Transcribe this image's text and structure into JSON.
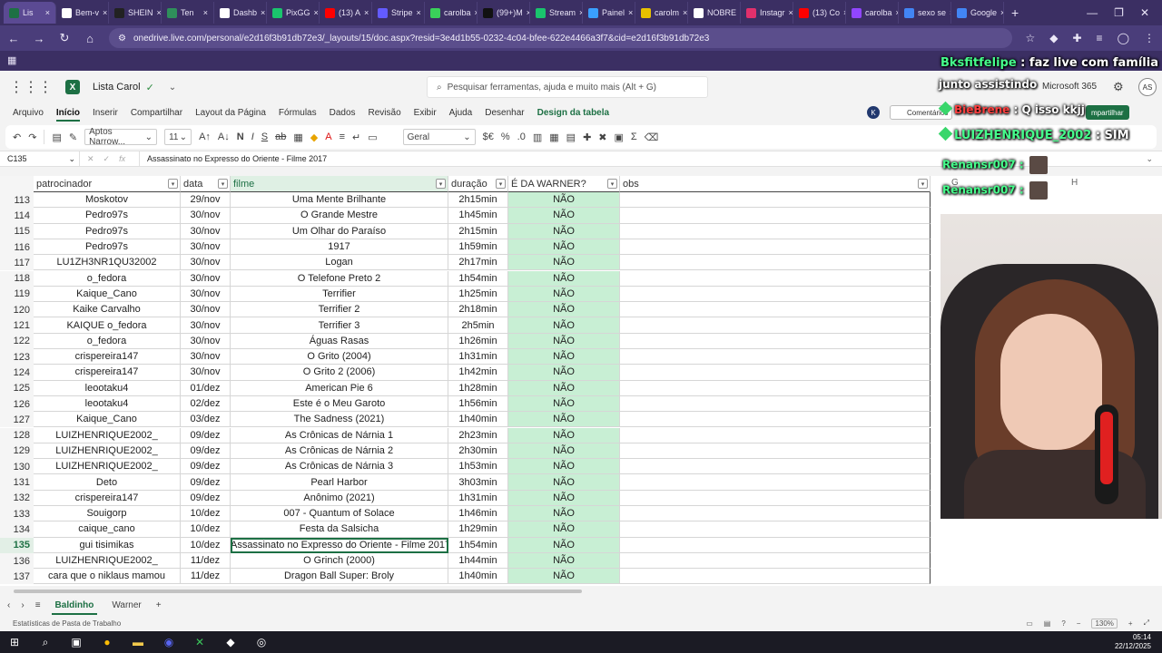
{
  "browser": {
    "tabs": [
      {
        "label": "Lis",
        "color": "#1d7044",
        "active": true
      },
      {
        "label": "Bem-v",
        "color": "#ffffff"
      },
      {
        "label": "SHEIN",
        "color": "#222222"
      },
      {
        "label": "Ten",
        "color": "#2f8f5b"
      },
      {
        "label": "Dashb",
        "color": "#ffffff"
      },
      {
        "label": "PixGG",
        "color": "#1ac46d"
      },
      {
        "label": "(13) A",
        "color": "#ff0000"
      },
      {
        "label": "Stripe",
        "color": "#635bff"
      },
      {
        "label": "carolba",
        "color": "#3ad15a"
      },
      {
        "label": "(99+)M",
        "color": "#111111"
      },
      {
        "label": "Stream",
        "color": "#1ac46d"
      },
      {
        "label": "Painel",
        "color": "#3aa0ff"
      },
      {
        "label": "carolm",
        "color": "#e8c100"
      },
      {
        "label": "NOBRE",
        "color": "#ffffff"
      },
      {
        "label": "Instagr",
        "color": "#e1306c"
      },
      {
        "label": "(13) Co",
        "color": "#ff0000"
      },
      {
        "label": "carolba",
        "color": "#9146ff"
      },
      {
        "label": "sexo se",
        "color": "#4285f4"
      },
      {
        "label": "Google",
        "color": "#4285f4"
      }
    ],
    "url": "onedrive.live.com/personal/e2d16f3b91db72e3/_layouts/15/doc.aspx?resid=3e4d1b55-0232-4c04-bfee-622e4466a3f7&cid=e2d16f3b91db72e3"
  },
  "excel": {
    "doc_name": "Lista Carol",
    "search_placeholder": "Pesquisar ferramentas, ajuda e muito mais (Alt + G)",
    "brand": "Microsoft 365",
    "avatar_initials": "AS",
    "k_badge": "K",
    "comments_label": "Comentários",
    "share_label": "mpartilhar",
    "menu_tabs": [
      "Arquivo",
      "Início",
      "Inserir",
      "Compartilhar",
      "Layout da Página",
      "Fórmulas",
      "Dados",
      "Revisão",
      "Exibir",
      "Ajuda",
      "Desenhar",
      "Design da tabela"
    ],
    "font_name": "Aptos Narrow...",
    "font_size": "11",
    "number_format": "Geral",
    "name_box": "C135",
    "formula": "Assassinato no Expresso do Oriente - Filme 2017",
    "columns": {
      "patrocinador": "patrocinador",
      "data": "data",
      "filme": "filme",
      "duracao": "duração",
      "warner": "É DA WARNER?",
      "obs": "obs",
      "g": "G",
      "h": "H"
    },
    "rows": [
      {
        "n": "113",
        "pat": "Moskotov",
        "data": "29/nov",
        "filme": "Uma Mente Brilhante",
        "dur": "2h15min",
        "warner": "NÃO"
      },
      {
        "n": "114",
        "pat": "Pedro97s",
        "data": "30/nov",
        "filme": "O Grande Mestre",
        "dur": "1h45min",
        "warner": "NÃO"
      },
      {
        "n": "115",
        "pat": "Pedro97s",
        "data": "30/nov",
        "filme": "Um Olhar do Paraíso",
        "dur": "2h15min",
        "warner": "NÃO"
      },
      {
        "n": "116",
        "pat": "Pedro97s",
        "data": "30/nov",
        "filme": "1917",
        "dur": "1h59min",
        "warner": "NÃO"
      },
      {
        "n": "117",
        "pat": "LU1ZH3NR1QU32002",
        "data": "30/nov",
        "filme": "Logan",
        "dur": "2h17min",
        "warner": "NÃO"
      },
      {
        "n": "118",
        "pat": "o_fedora",
        "data": "30/nov",
        "filme": "O Telefone Preto 2",
        "dur": "1h54min",
        "warner": "NÃO"
      },
      {
        "n": "119",
        "pat": "Kaique_Cano",
        "data": "30/nov",
        "filme": "Terrifier",
        "dur": "1h25min",
        "warner": "NÃO"
      },
      {
        "n": "120",
        "pat": "Kaike Carvalho",
        "data": "30/nov",
        "filme": "Terrifier  2",
        "dur": "2h18min",
        "warner": "NÃO"
      },
      {
        "n": "121",
        "pat": "KAIQUE o_fedora",
        "data": "30/nov",
        "filme": "Terrifier 3",
        "dur": "2h5min",
        "warner": "NÃO"
      },
      {
        "n": "122",
        "pat": "o_fedora",
        "data": "30/nov",
        "filme": "Águas Rasas",
        "dur": "1h26min",
        "warner": "NÃO"
      },
      {
        "n": "123",
        "pat": "crispereira147",
        "data": "30/nov",
        "filme": "O Grito (2004)",
        "dur": "1h31min",
        "warner": "NÃO"
      },
      {
        "n": "124",
        "pat": "crispereira147",
        "data": "30/nov",
        "filme": "O Grito 2 (2006)",
        "dur": "1h42min",
        "warner": "NÃO"
      },
      {
        "n": "125",
        "pat": "leootaku4",
        "data": "01/dez",
        "filme": "American Pie 6",
        "dur": "1h28min",
        "warner": "NÃO"
      },
      {
        "n": "126",
        "pat": "leootaku4",
        "data": "02/dez",
        "filme": "Este é o Meu Garoto",
        "dur": "1h56min",
        "warner": "NÃO"
      },
      {
        "n": "127",
        "pat": "Kaique_Cano",
        "data": "03/dez",
        "filme": "The Sadness (2021)",
        "dur": "1h40min",
        "warner": "NÃO"
      },
      {
        "n": "128",
        "pat": "LUIZHENRIQUE2002_",
        "data": "09/dez",
        "filme": "As Crônicas de Nárnia 1",
        "dur": "2h23min",
        "warner": "NÃO"
      },
      {
        "n": "129",
        "pat": "LUIZHENRIQUE2002_",
        "data": "09/dez",
        "filme": "As Crônicas de Nárnia 2",
        "dur": "2h30min",
        "warner": "NÃO"
      },
      {
        "n": "130",
        "pat": "LUIZHENRIQUE2002_",
        "data": "09/dez",
        "filme": "As Crônicas de Nárnia 3",
        "dur": "1h53min",
        "warner": "NÃO"
      },
      {
        "n": "131",
        "pat": "Deto",
        "data": "09/dez",
        "filme": "Pearl Harbor",
        "dur": "3h03min",
        "warner": "NÃO"
      },
      {
        "n": "132",
        "pat": "crispereira147",
        "data": "09/dez",
        "filme": "Anônimo (2021)",
        "dur": "1h31min",
        "warner": "NÃO"
      },
      {
        "n": "133",
        "pat": "Souigorp",
        "data": "10/dez",
        "filme": "007 - Quantum of Solace",
        "dur": "1h46min",
        "warner": "NÃO"
      },
      {
        "n": "134",
        "pat": "caique_cano",
        "data": "10/dez",
        "filme": "Festa da Salsicha",
        "dur": "1h29min",
        "warner": "NÃO"
      },
      {
        "n": "135",
        "pat": "gui tisimikas",
        "data": "10/dez",
        "filme": "Assassinato no Expresso do Oriente - Filme 2017",
        "dur": "1h54min",
        "warner": "NÃO",
        "selected": true
      },
      {
        "n": "136",
        "pat": "LUIZHENRIQUE2002_",
        "data": "11/dez",
        "filme": "O Grinch (2000)",
        "dur": "1h44min",
        "warner": "NÃO"
      },
      {
        "n": "137",
        "pat": "cara que o niklaus mamou",
        "data": "11/dez",
        "filme": "Dragon Ball Super: Broly",
        "dur": "1h40min",
        "warner": "NÃO"
      }
    ],
    "sheet_tabs": [
      "Baldinho",
      "Warner"
    ],
    "status_left": "Estatísticas de Pasta de Trabalho",
    "zoom": "130%"
  },
  "overlay": {
    "chat1_user": "Bksfitfelipe",
    "chat1_msg": " : faz live com família",
    "chat2": "junto assistindo",
    "chat3_user": "BieBrene",
    "chat3_msg": " : Q isso kkjj",
    "chat4_user": "LUIZHENRIQUE_2002",
    "chat4_msg": " : SIM",
    "chat5": "Renansr007 :",
    "chat6": "Renansr007 :"
  },
  "taskbar": {
    "time": "05:14",
    "date": "22/12/2025"
  }
}
